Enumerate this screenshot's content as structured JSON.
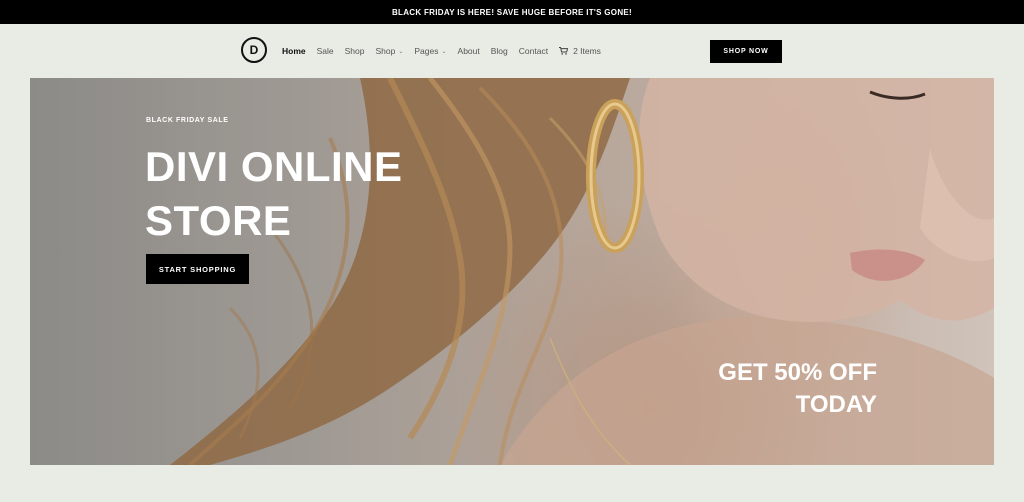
{
  "announcement": {
    "text": "BLACK FRIDAY IS HERE! SAVE HUGE BEFORE IT'S GONE!"
  },
  "header": {
    "logo_letter": "D",
    "nav": [
      {
        "label": "Home",
        "active": true
      },
      {
        "label": "Sale"
      },
      {
        "label": "Shop"
      },
      {
        "label": "Shop",
        "dropdown": true
      },
      {
        "label": "Pages",
        "dropdown": true
      },
      {
        "label": "About"
      },
      {
        "label": "Blog"
      },
      {
        "label": "Contact"
      }
    ],
    "cart": {
      "icon": "cart-icon",
      "label": "2 Items"
    },
    "cta_label": "SHOP NOW"
  },
  "hero": {
    "eyebrow": "BLACK FRIDAY SALE",
    "title_line1": "DIVI ONLINE",
    "title_line2": "STORE",
    "button_label": "START SHOPPING",
    "promo_line1": "GET 50% OFF",
    "promo_line2": "TODAY"
  },
  "colors": {
    "topbar": "#000000",
    "page_bg": "#e9ebe5",
    "button_bg": "#000000",
    "button_text": "#ffffff"
  }
}
